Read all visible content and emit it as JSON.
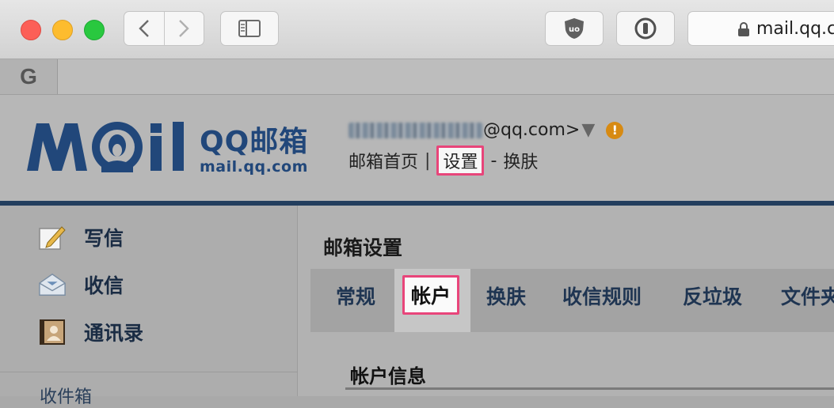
{
  "browser": {
    "url": "mail.qq.co",
    "favicon_tab": "G"
  },
  "header": {
    "logo_text": "QQ邮箱",
    "logo_url": "mail.qq.com",
    "account_suffix": "@qq.com>",
    "account_arrow": "▼",
    "warning": "!",
    "links": {
      "home": "邮箱首页",
      "separator": "|",
      "settings": "设置",
      "dash": "-",
      "skin": "换肤"
    }
  },
  "sidebar": {
    "items": [
      {
        "label": "写信",
        "icon": "compose-icon"
      },
      {
        "label": "收信",
        "icon": "inbox-tray-icon"
      },
      {
        "label": "通讯录",
        "icon": "contacts-icon"
      }
    ],
    "folder_partial": "收件箱"
  },
  "main": {
    "title": "邮箱设置",
    "tabs": [
      "常规",
      "帐户",
      "换肤",
      "收信规则",
      "反垃圾",
      "文件夹"
    ],
    "active_tab": "帐户",
    "section_title": "帐户信息"
  }
}
